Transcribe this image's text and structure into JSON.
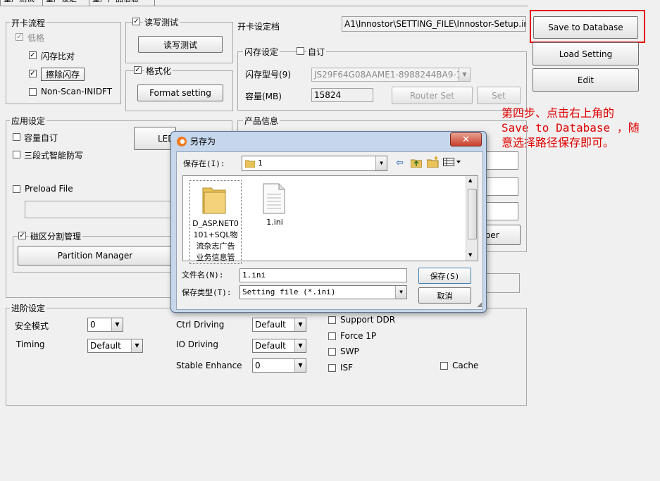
{
  "tabs": [
    "量产测试",
    "量产设定",
    "量产产品信息"
  ],
  "card_flow": {
    "title": "开卡流程",
    "items": [
      {
        "label": "低格",
        "checked": true,
        "disabled": true
      },
      {
        "label": "闪存比对",
        "checked": true
      },
      {
        "label": "擦除闪存",
        "checked": true
      },
      {
        "label": "Non-Scan-INIDFT",
        "checked": false
      }
    ]
  },
  "rw_test": {
    "label": "读写测试",
    "checked": true,
    "button": "读写测试"
  },
  "format": {
    "label": "格式化",
    "checked": true,
    "button": "Format setting"
  },
  "setting_file": {
    "label": "开卡设定档",
    "path": "A1\\Innostor\\SETTING_FILE\\Innostor-Setup.ini"
  },
  "right_buttons": {
    "save": "Save to Database",
    "load": "Load Setting",
    "edit": "Edit"
  },
  "flash": {
    "title": "闪存设定",
    "custom_label": "自订",
    "model_label": "闪存型号(9)",
    "model_value": "JS29F64G08AAME1-8988244BA9-1",
    "capacity_label": "容量(MB)",
    "capacity_value": "15824",
    "router_set": "Router Set",
    "set": "Set"
  },
  "app": {
    "title": "应用设定",
    "capacity_custom": "容量自订",
    "smart_protect": "三段式智能防写",
    "led_button": "LED",
    "preload_label": "Preload File",
    "partition_label": "磁区分割管理",
    "partition_button": "Partition Manager"
  },
  "product_info": {
    "title": "产品信息",
    "number_button": "mber"
  },
  "advanced": {
    "title": "进阶设定",
    "safe_mode_label": "安全模式",
    "safe_mode_value": "0",
    "timing_label": "Timing",
    "timing_value": "Default",
    "ctrl_driving_label": "Ctrl Driving",
    "ctrl_driving_value": "Default",
    "io_driving_label": "IO Driving",
    "io_driving_value": "Default",
    "stable_label": "Stable Enhance",
    "stable_value": "0",
    "support_ddr": "Support DDR",
    "force1p": "Force 1P",
    "swp": "SWP",
    "isf": "ISF",
    "cache": "Cache"
  },
  "annotation": "第四步、点击右上角的\nSave to Database ，随\n意选择路径保存即可。",
  "dialog": {
    "title": "另存为",
    "save_in_label": "保存在(I):",
    "save_in_value": "1",
    "files": [
      {
        "name": "D_ASP.NET0\n101+SQL物\n流杂志广告\n业务信息管",
        "type": "folder"
      },
      {
        "name": "1.ini",
        "type": "file"
      }
    ],
    "filename_label": "文件名(N):",
    "filename_value": "1.ini",
    "filetype_label": "保存类型(T):",
    "filetype_value": "Setting file (*.ini)",
    "save_button": "保存(S)",
    "cancel_button": "取消"
  },
  "colors": {
    "highlight": "#e00000",
    "dialog_frame": "#c6d7ec",
    "folder": "#e8c35a"
  }
}
